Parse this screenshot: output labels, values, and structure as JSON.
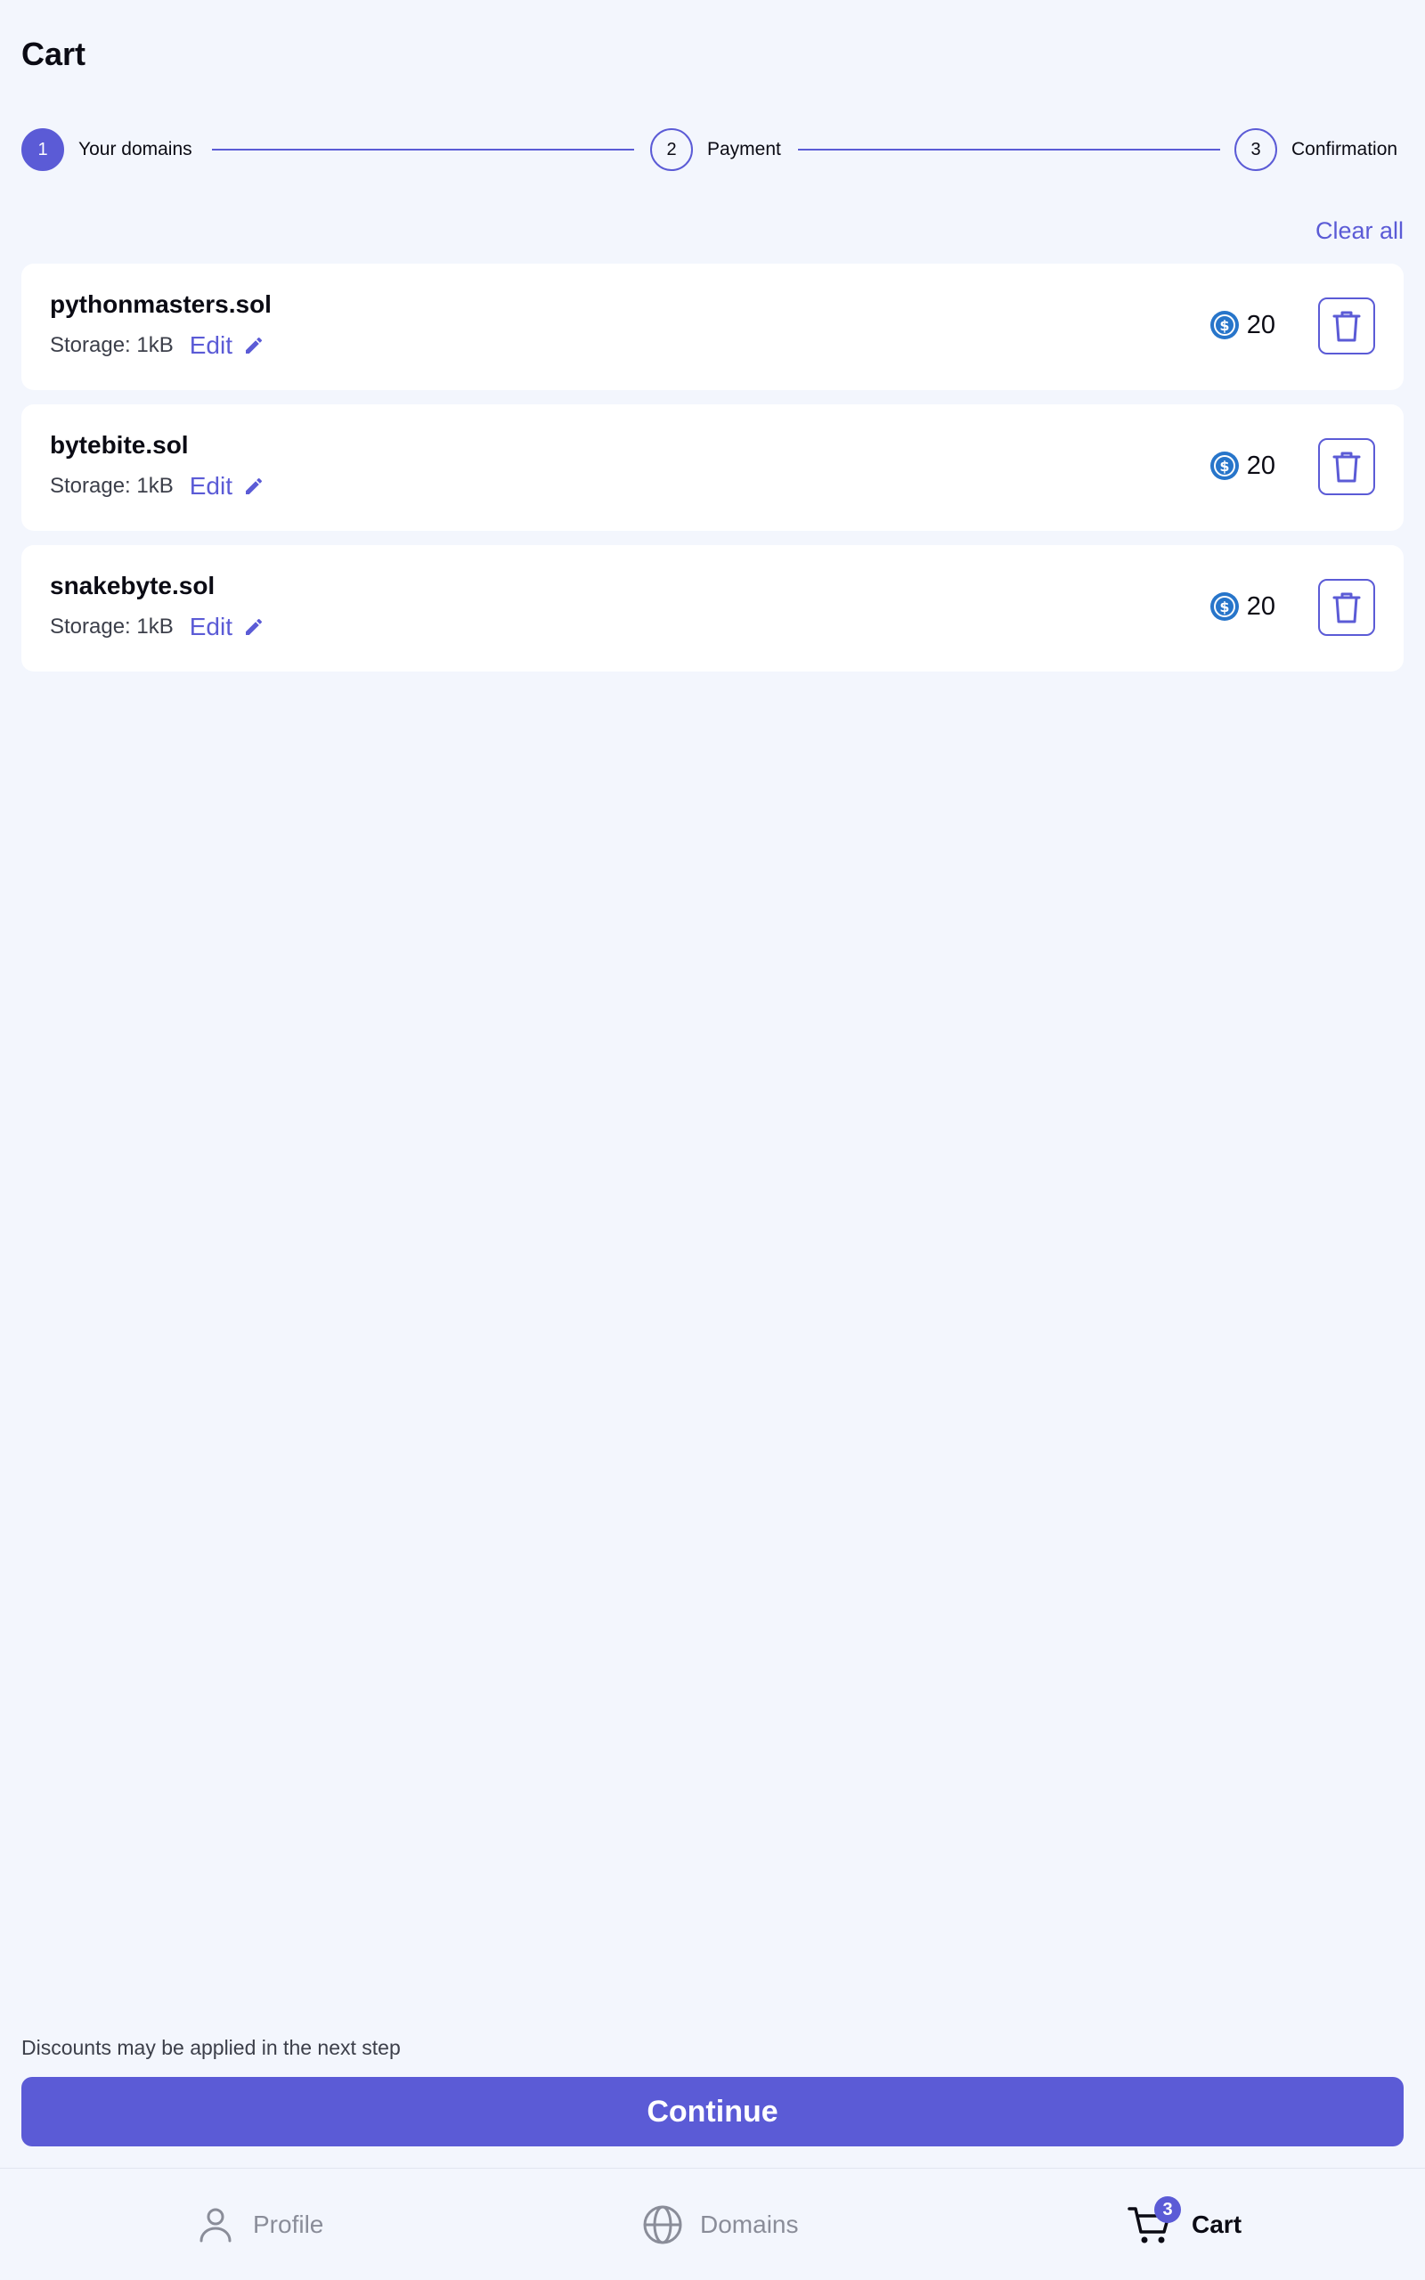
{
  "page": {
    "title": "Cart"
  },
  "stepper": {
    "steps": [
      {
        "number": "1",
        "label": "Your domains",
        "active": true
      },
      {
        "number": "2",
        "label": "Payment",
        "active": false
      },
      {
        "number": "3",
        "label": "Confirmation",
        "active": false
      }
    ]
  },
  "cart": {
    "clear_all_label": "Clear all",
    "items": [
      {
        "name": "pythonmasters.sol",
        "storage": "Storage: 1kB",
        "edit_label": "Edit",
        "price": "20"
      },
      {
        "name": "bytebite.sol",
        "storage": "Storage: 1kB",
        "edit_label": "Edit",
        "price": "20"
      },
      {
        "name": "snakebyte.sol",
        "storage": "Storage: 1kB",
        "edit_label": "Edit",
        "price": "20"
      }
    ]
  },
  "footer": {
    "discount_note": "Discounts may be applied in the next step",
    "continue_label": "Continue"
  },
  "bottom_nav": {
    "items": [
      {
        "label": "Profile",
        "icon": "user-icon",
        "active": false
      },
      {
        "label": "Domains",
        "icon": "globe-icon",
        "active": false
      },
      {
        "label": "Cart",
        "icon": "cart-icon",
        "active": true,
        "badge": "3"
      }
    ]
  },
  "colors": {
    "accent": "#5b5bd6",
    "background": "#f3f6fd",
    "card": "#ffffff",
    "coin": "#2775ca"
  }
}
